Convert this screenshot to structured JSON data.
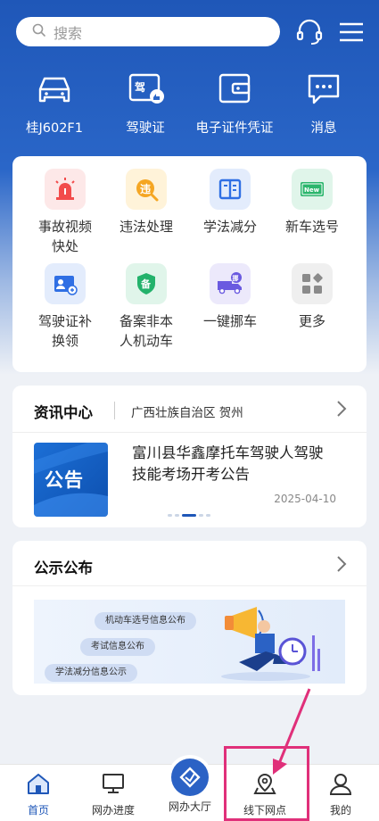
{
  "search": {
    "placeholder": "搜索"
  },
  "top_icons": [
    "headset-icon",
    "menu-icon"
  ],
  "quick_links": [
    {
      "label": "桂J602F1",
      "icon": "car-icon"
    },
    {
      "label": "驾驶证",
      "icon": "license-icon",
      "icon_text": "驾"
    },
    {
      "label": "电子证件凭证",
      "icon": "wallet-icon"
    },
    {
      "label": "消息",
      "icon": "message-icon"
    }
  ],
  "services": [
    {
      "label": "事故视频快处",
      "icon": "alarm-icon",
      "color": "#f24c4c"
    },
    {
      "label": "违法处理",
      "icon": "violation-icon",
      "icon_text": "违",
      "color": "#f5a623"
    },
    {
      "label": "学法减分",
      "icon": "book-icon",
      "color": "#2f6fe4"
    },
    {
      "label": "新车选号",
      "icon": "new-plate-icon",
      "icon_text": "New",
      "color": "#2cb66d"
    },
    {
      "label": "驾驶证补换领",
      "icon": "id-card-icon",
      "color": "#2f6fe4"
    },
    {
      "label": "备案非本人机动车",
      "icon": "shield-icon",
      "icon_text": "备",
      "color": "#23b26b"
    },
    {
      "label": "一键挪车",
      "icon": "truck-icon",
      "icon_text": "挪",
      "color": "#6a5ae0"
    },
    {
      "label": "更多",
      "icon": "more-grid-icon",
      "color": "#8a8a8a"
    }
  ],
  "news": {
    "title": "资讯中心",
    "region": "广西壮族自治区 贺州",
    "thumb_text": "公告",
    "headline": "富川县华鑫摩托车驾驶人驾驶技能考场开考公告",
    "date": "2025-04-10"
  },
  "public": {
    "title": "公示公布",
    "pills": [
      "机动车选号信息公布",
      "考试信息公布",
      "学法减分信息公示"
    ]
  },
  "nav": [
    {
      "label": "首页",
      "icon": "home-icon",
      "active": true
    },
    {
      "label": "网办进度",
      "icon": "monitor-icon"
    },
    {
      "label": "网办大厅",
      "icon": "hall-icon"
    },
    {
      "label": "线下网点",
      "icon": "location-icon"
    },
    {
      "label": "我的",
      "icon": "user-icon"
    }
  ],
  "colors": {
    "primary": "#1f57b8",
    "highlight": "#e0307a"
  }
}
